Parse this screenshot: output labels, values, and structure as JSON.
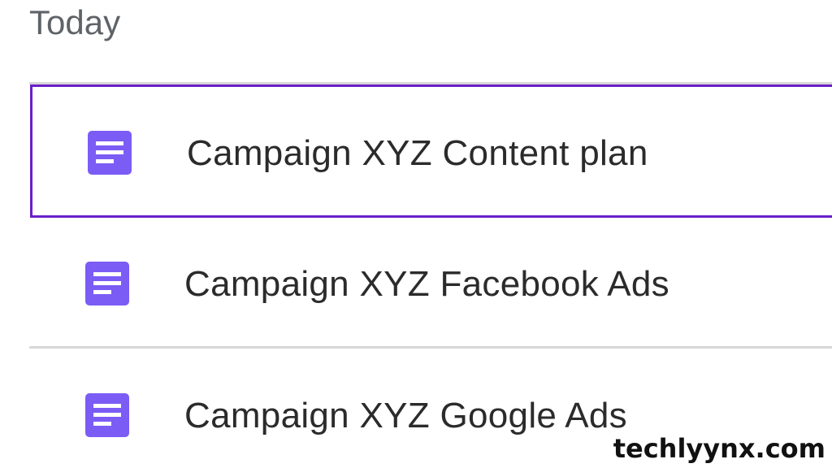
{
  "section": {
    "heading": "Today"
  },
  "files": [
    {
      "name": "Campaign XYZ Content plan",
      "icon": "document-icon",
      "selected": true
    },
    {
      "name": "Campaign XYZ Facebook Ads",
      "icon": "document-icon",
      "selected": false
    },
    {
      "name": "Campaign XYZ Google Ads",
      "icon": "document-icon",
      "selected": false
    }
  ],
  "watermark": {
    "text": "techlyynx.com"
  },
  "colors": {
    "icon": "#7b5cf5",
    "selection_border": "#6a1fc8",
    "heading_text": "#5f6368",
    "item_text": "#2b2b2b",
    "divider": "#d7d7d7"
  }
}
